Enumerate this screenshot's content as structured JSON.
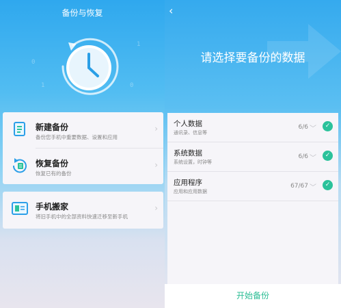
{
  "left": {
    "title": "备份与恢复",
    "menu": [
      {
        "title": "新建备份",
        "desc": "备份您手机中重要数据、设置和应用"
      },
      {
        "title": "恢复备份",
        "desc": "恢复已有的备份"
      },
      {
        "title": "手机搬家",
        "desc": "将旧手机中的全部资料快速迁移至新手机"
      }
    ]
  },
  "right": {
    "title": "请选择要备份的数据",
    "items": [
      {
        "name": "个人数据",
        "desc": "通讯录、信息等",
        "count": "6/6"
      },
      {
        "name": "系统数据",
        "desc": "系统设置，时钟等",
        "count": "6/6"
      },
      {
        "name": "应用程序",
        "desc": "应用和应用数据",
        "count": "67/67"
      }
    ],
    "start_label": "开始备份"
  },
  "colors": {
    "accent_green": "#2bc29b",
    "header_blue": "#35aaee"
  }
}
